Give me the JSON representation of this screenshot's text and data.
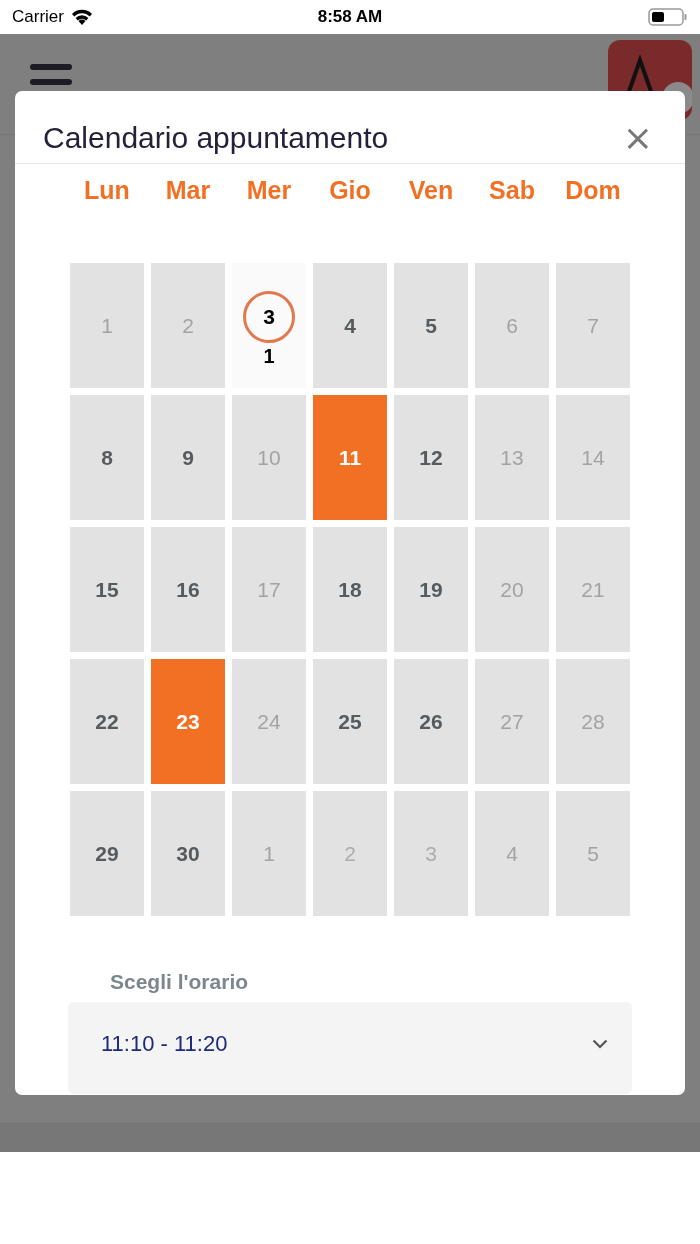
{
  "status_bar": {
    "carrier": "Carrier",
    "time": "8:58 AM"
  },
  "modal": {
    "title": "Calendario appuntamento",
    "close": "×"
  },
  "weekdays": [
    "Lun",
    "Mar",
    "Mer",
    "Gio",
    "Ven",
    "Sab",
    "Dom"
  ],
  "days": [
    {
      "day": "1",
      "kind": "unavailable",
      "selected": false
    },
    {
      "day": "2",
      "kind": "unavailable",
      "selected": false
    },
    {
      "day": "3",
      "kind": "today",
      "count": "1",
      "selected": false
    },
    {
      "day": "4",
      "kind": "available",
      "selected": false
    },
    {
      "day": "5",
      "kind": "available",
      "selected": false
    },
    {
      "day": "6",
      "kind": "unavailable",
      "selected": false
    },
    {
      "day": "7",
      "kind": "unavailable",
      "selected": false
    },
    {
      "day": "8",
      "kind": "available",
      "selected": false
    },
    {
      "day": "9",
      "kind": "available",
      "selected": false
    },
    {
      "day": "10",
      "kind": "unavailable",
      "selected": false
    },
    {
      "day": "11",
      "kind": "available",
      "selected": true
    },
    {
      "day": "12",
      "kind": "available",
      "selected": false
    },
    {
      "day": "13",
      "kind": "unavailable",
      "selected": false
    },
    {
      "day": "14",
      "kind": "unavailable",
      "selected": false
    },
    {
      "day": "15",
      "kind": "available",
      "selected": false
    },
    {
      "day": "16",
      "kind": "available",
      "selected": false
    },
    {
      "day": "17",
      "kind": "unavailable",
      "selected": false
    },
    {
      "day": "18",
      "kind": "available",
      "selected": false
    },
    {
      "day": "19",
      "kind": "available",
      "selected": false
    },
    {
      "day": "20",
      "kind": "unavailable",
      "selected": false
    },
    {
      "day": "21",
      "kind": "unavailable",
      "selected": false
    },
    {
      "day": "22",
      "kind": "available",
      "selected": false
    },
    {
      "day": "23",
      "kind": "available",
      "selected": true
    },
    {
      "day": "24",
      "kind": "unavailable",
      "selected": false
    },
    {
      "day": "25",
      "kind": "available",
      "selected": false
    },
    {
      "day": "26",
      "kind": "available",
      "selected": false
    },
    {
      "day": "27",
      "kind": "unavailable",
      "selected": false
    },
    {
      "day": "28",
      "kind": "unavailable",
      "selected": false
    },
    {
      "day": "29",
      "kind": "available",
      "selected": false
    },
    {
      "day": "30",
      "kind": "available",
      "selected": false
    },
    {
      "day": "1",
      "kind": "unavailable",
      "selected": false
    },
    {
      "day": "2",
      "kind": "outside",
      "selected": false
    },
    {
      "day": "3",
      "kind": "outside",
      "selected": false
    },
    {
      "day": "4",
      "kind": "unavailable",
      "selected": false
    },
    {
      "day": "5",
      "kind": "unavailable",
      "selected": false
    }
  ],
  "time_picker": {
    "label": "Scegli l'orario",
    "value": "11:10 - 11:20"
  }
}
